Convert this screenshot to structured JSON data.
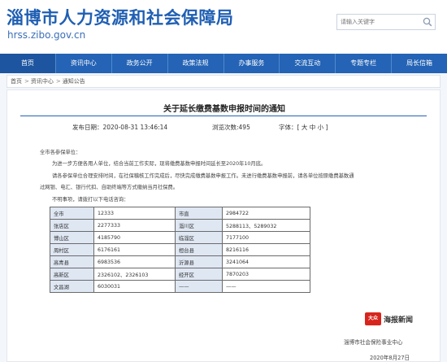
{
  "header": {
    "site_title": "淄博市人力资源和社会保障局",
    "site_url": "hrss.zibo.gov.cn",
    "search_placeholder": "请输入关键字"
  },
  "nav": {
    "items": [
      "首页",
      "资讯中心",
      "政务公开",
      "政策法规",
      "办事服务",
      "交流互动",
      "专题专栏",
      "局长信箱"
    ]
  },
  "breadcrumb": {
    "items": [
      "首页",
      "资讯中心",
      "通知公告"
    ]
  },
  "article": {
    "title": "关于延长缴费基数申报时间的通知",
    "publish_label": "发布日期：",
    "publish_time": "2020-08-31 13:46:14",
    "views_label": "浏览次数:",
    "views": "495",
    "font_label": "字体：",
    "font_sizes": [
      "大",
      "中",
      "小"
    ],
    "greeting": "全市各参保单位：",
    "paragraphs": [
      "为进一步方便各用人单位，结合当前工作实际，现将缴费基数申报时间延长至2020年10月底。",
      "请各参保单位合理安排时间，在社保稽核工作完成后，尽快完成缴费基数申报工作。未进行缴费基数申报前，请各单位按原缴费基数通",
      "过网银、电汇、银行代扣、自助终端等方式缴纳当月社保费。",
      "不明事项，请拨打以下电话咨询："
    ],
    "contacts": [
      [
        "全市",
        "12333",
        "市直",
        "2984722"
      ],
      [
        "张店区",
        "2277333",
        "淄川区",
        "5288113、5289032"
      ],
      [
        "博山区",
        "4185790",
        "临淄区",
        "7177100"
      ],
      [
        "周村区",
        "6176161",
        "桓台县",
        "8216116"
      ],
      [
        "高青县",
        "6983536",
        "沂源县",
        "3241064"
      ],
      [
        "高新区",
        "2326102、2326103",
        "经开区",
        "7870203"
      ],
      [
        "文昌湖",
        "6030031",
        "——",
        "——"
      ]
    ],
    "signature_org": "淄博市社会保险事业中心",
    "signature_date": "2020年8月27日"
  },
  "watermark": {
    "badge": "大众",
    "text": "海报新闻"
  },
  "colors": {
    "brand_blue": "#2463b5",
    "table_header_bg": "#dfe7f3",
    "page_bg": "#f3f6fa"
  }
}
